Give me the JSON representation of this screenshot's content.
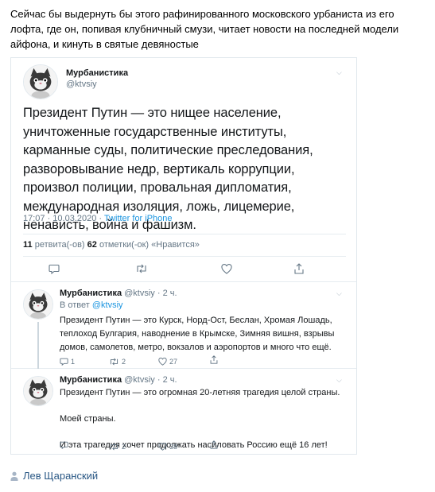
{
  "post": {
    "text": "Сейчас бы выдернуть бы этого рафинированного московского урбаниста из его лофта, где он, попивая клубничный смузи, читает новости на последней модели айфона, и кинуть в святые девяностые",
    "author": "Лев Щаранский"
  },
  "tweet": {
    "name": "Мурбанистика",
    "handle": "@ktvsiy",
    "body": "Президент Путин — это нищее население, уничтоженные государственные институты, карманные суды, политические преследования, разворовывание недр, вертикаль коррупции, произвол полиции, провальная дипломатия, международная изоляция, ложь, лицемерие, ненависть, война и фашизм.",
    "time": "17:07 · 10.03.2020 · ",
    "via": "Twitter for iPhone",
    "retweets_count": "11",
    "retweets_label": " ретвита(-ов)  ",
    "likes_count": "62",
    "likes_label": " отметки(-ок) «Нравится»"
  },
  "replies": [
    {
      "name": "Мурбанистика",
      "meta": " @ktvsiy · 2 ч.",
      "reply_to_label": "В ответ ",
      "reply_to_handle": "@ktvsiy",
      "body": "Президент Путин — это Курск, Норд-Ост, Беслан, Хромая Лошадь, теплоход Булгария, наводнение в Крымске, Зимняя вишня, взрывы домов, самолетов, метро, вокзалов и аэропортов и много что ещё.",
      "comments": "1",
      "retweets": "2",
      "likes": "27"
    },
    {
      "name": "Мурбанистика",
      "meta": " @ktvsiy · 2 ч.",
      "paragraphs": [
        "Президент Путин — это огромная 20-летняя трагедия целой страны.",
        "Моей страны.",
        "И эта трагедия хочет продолжать насиловать Россию ещё 16 лет!"
      ],
      "comments": "",
      "retweets": "2",
      "likes": "38"
    }
  ],
  "icons": {
    "chevron": "chevron-down-icon",
    "comment": "comment-icon",
    "retweet": "retweet-icon",
    "like": "heart-icon",
    "share": "share-icon",
    "user": "user-icon"
  },
  "colors": {
    "link": "#1b95e0",
    "muted": "#657786",
    "author_link": "#2a5885"
  }
}
